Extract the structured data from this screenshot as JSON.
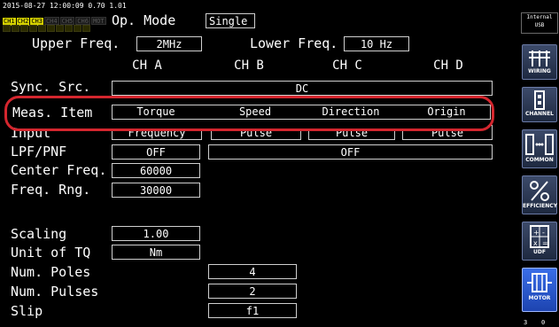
{
  "status": {
    "datetime": "2015-08-27 12:00:09",
    "version": "0.70 1.01",
    "channels": [
      "CH1",
      "CH2",
      "CH3",
      "CH4",
      "CH5",
      "CH6",
      "MOT"
    ],
    "active_channels": [
      "CH1",
      "CH2",
      "CH3"
    ]
  },
  "op_mode": {
    "label": "Op. Mode",
    "value": "Single"
  },
  "freq": {
    "upper_label": "Upper Freq.",
    "upper_value": "2MHz",
    "lower_label": "Lower Freq.",
    "lower_value": "10 Hz"
  },
  "columns": [
    "CH A",
    "CH B",
    "CH C",
    "CH D"
  ],
  "rows": {
    "sync_src": {
      "label": "Sync. Src.",
      "value": "DC"
    },
    "meas_item": {
      "label": "Meas. Item",
      "values": [
        "Torque",
        "Speed",
        "Direction",
        "Origin"
      ]
    },
    "input": {
      "label": "Input",
      "values": [
        "Frequency",
        "Pulse",
        "Pulse",
        "Pulse"
      ]
    },
    "lpf_pnf": {
      "label": "LPF/PNF",
      "value_a": "OFF",
      "value_bcd": "OFF"
    },
    "center_freq": {
      "label": "Center Freq.",
      "value": "60000"
    },
    "freq_rng": {
      "label": "Freq. Rng.",
      "value": "30000"
    },
    "scaling": {
      "label": "Scaling",
      "value": "1.00"
    },
    "unit_tq": {
      "label": "Unit of TQ",
      "value": "Nm"
    },
    "num_poles": {
      "label": "Num. Poles",
      "value": "4"
    },
    "num_pulses": {
      "label": "Num. Pulses",
      "value": "2"
    },
    "slip": {
      "label": "Slip",
      "value": "f1"
    }
  },
  "sidebar": {
    "storage_top": "Internal",
    "storage_bottom": "USB",
    "buttons": [
      {
        "label": "WIRING",
        "icon": "wiring-icon"
      },
      {
        "label": "CHANNEL",
        "icon": "channel-icon"
      },
      {
        "label": "COMMON",
        "icon": "common-icon"
      },
      {
        "label": "EFFICIENCY",
        "icon": "efficiency-icon"
      },
      {
        "label": "UDF",
        "icon": "udf-icon"
      },
      {
        "label": "MOTOR",
        "icon": "motor-icon"
      }
    ],
    "footer_left": "3",
    "footer_right": "0"
  },
  "colors": {
    "background": "#000000",
    "highlight": "#d4262e",
    "active_channel": "#d6d200",
    "sidebar_active": "#2e5fd8"
  }
}
